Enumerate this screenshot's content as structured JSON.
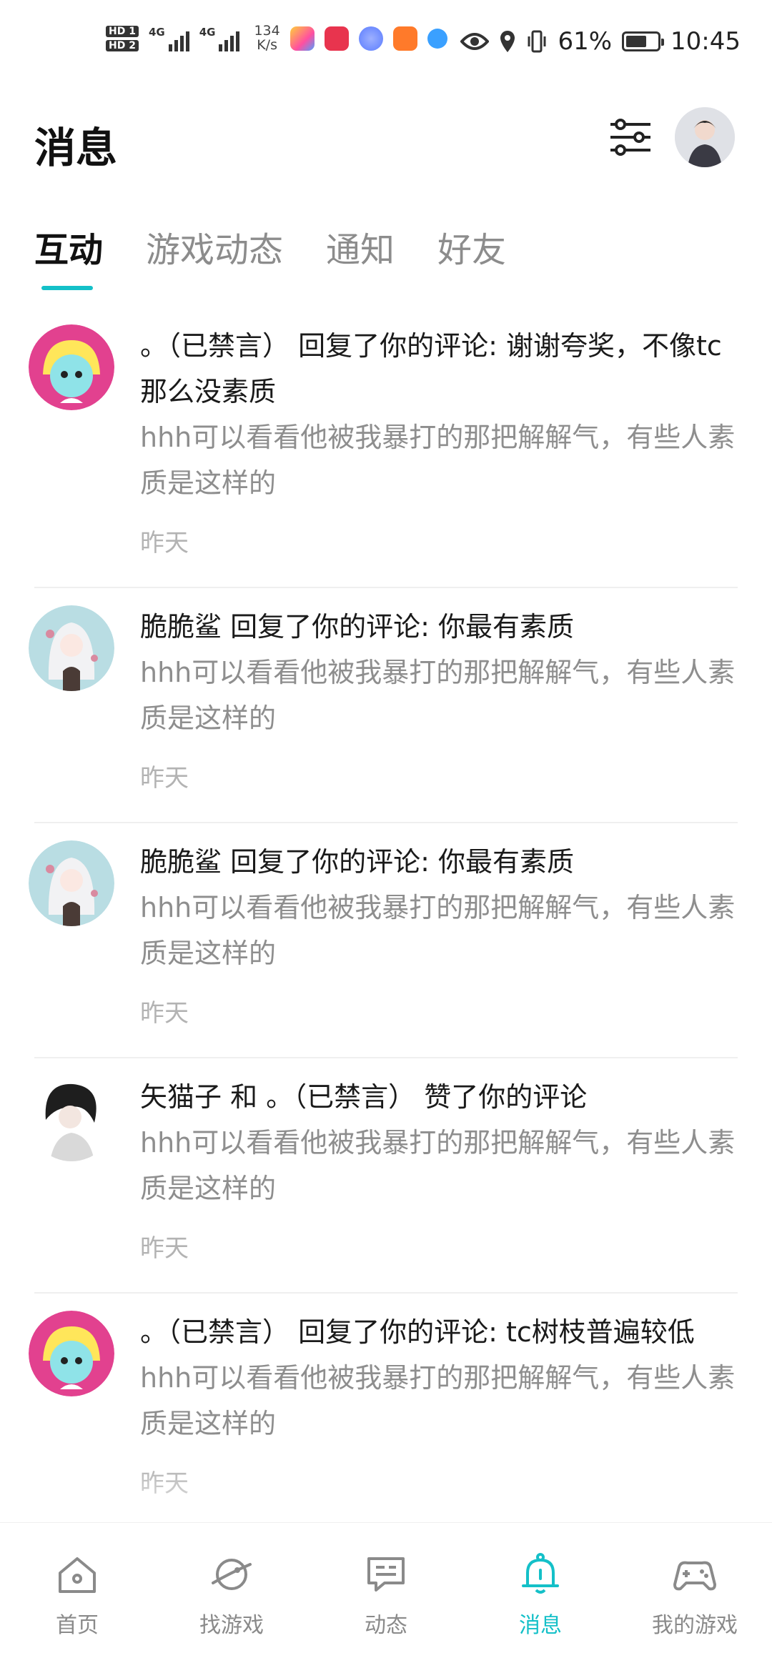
{
  "status_bar": {
    "hd1": "HD 1",
    "hd2": "HD 2",
    "net1": "4G",
    "net2": "4G",
    "speed_value": "134",
    "speed_unit": "K/s",
    "battery": "61%",
    "time": "10:45",
    "app_icon_colors": [
      "#ff6aa2",
      "#e8344e",
      "#5a7cff",
      "#ff7a2a",
      "#3aa0ff"
    ]
  },
  "header": {
    "title": "消息",
    "filter_icon": "sliders-icon",
    "avatar_icon": "user-avatar"
  },
  "tabs": [
    {
      "label": "互动",
      "active": true
    },
    {
      "label": "游戏动态",
      "active": false
    },
    {
      "label": "通知",
      "active": false
    },
    {
      "label": "好友",
      "active": false
    }
  ],
  "feed": [
    {
      "avatar": "yellow-character-avatar",
      "title": "。（已禁言） 回复了你的评论: 谢谢夸奖，不像tc那么没素质",
      "snippet": "hhh可以看看他被我暴打的那把解解气，有些人素质是这样的",
      "time": "昨天"
    },
    {
      "avatar": "white-hair-girl-avatar",
      "title": "脆脆鲨 回复了你的评论: 你最有素质",
      "snippet": "hhh可以看看他被我暴打的那把解解气，有些人素质是这样的",
      "time": "昨天"
    },
    {
      "avatar": "white-hair-girl-avatar",
      "title": "脆脆鲨 回复了你的评论: 你最有素质",
      "snippet": "hhh可以看看他被我暴打的那把解解气，有些人素质是这样的",
      "time": "昨天"
    },
    {
      "avatar": "dark-hair-boy-avatar",
      "title": "矢猫子 和 。（已禁言） 赞了你的评论",
      "snippet": "hhh可以看看他被我暴打的那把解解气，有些人素质是这样的",
      "time": "昨天"
    },
    {
      "avatar": "yellow-character-avatar",
      "title": "。（已禁言） 回复了你的评论: tc树枝普遍较低",
      "snippet": "hhh可以看看他被我暴打的那把解解气，有些人素质是这样的",
      "time": "昨天"
    }
  ],
  "bottom_nav": [
    {
      "label": "首页",
      "icon": "home-icon",
      "active": false
    },
    {
      "label": "找游戏",
      "icon": "planet-icon",
      "active": false
    },
    {
      "label": "动态",
      "icon": "chat-bubble-icon",
      "active": false
    },
    {
      "label": "消息",
      "icon": "bell-icon",
      "active": true
    },
    {
      "label": "我的游戏",
      "icon": "gamepad-icon",
      "active": false
    }
  ],
  "colors": {
    "accent": "#14c0c8",
    "muted": "#8e8e8e",
    "time": "#b3b3b3"
  }
}
